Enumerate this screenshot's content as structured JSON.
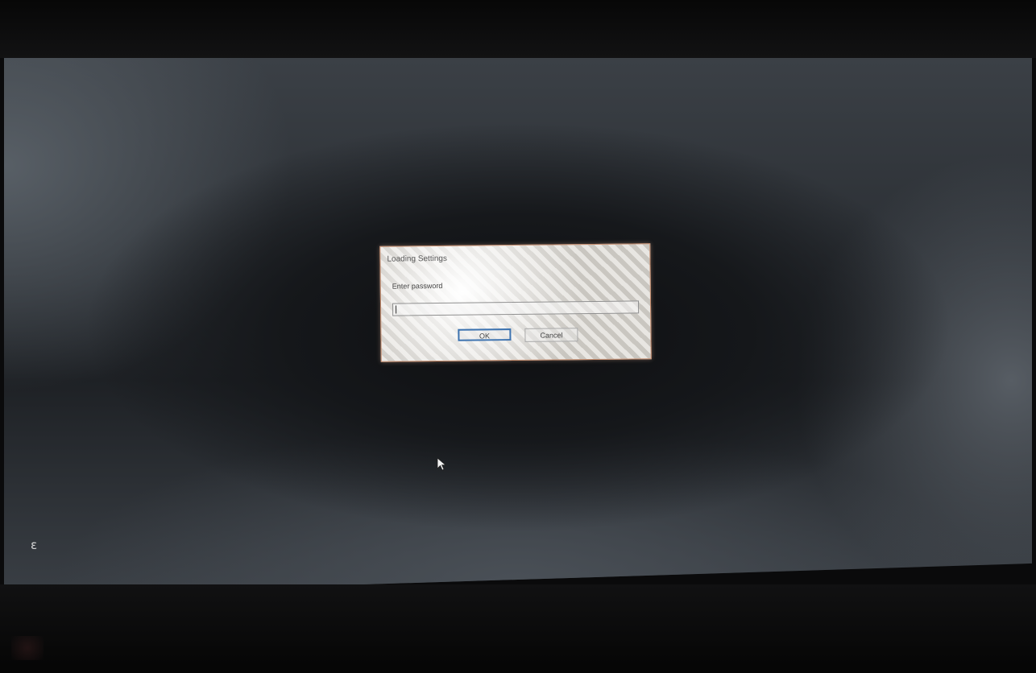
{
  "dialog": {
    "title": "Loading Settings",
    "prompt": "Enter password",
    "password_value": "",
    "ok_label": "OK",
    "cancel_label": "Cancel"
  },
  "taskbar": {
    "glyph": "ɛ"
  },
  "icons": {
    "cursor": "mouse-pointer-icon"
  },
  "colors": {
    "focus_border": "#3d73b0",
    "dialog_border": "#c58a6a"
  }
}
